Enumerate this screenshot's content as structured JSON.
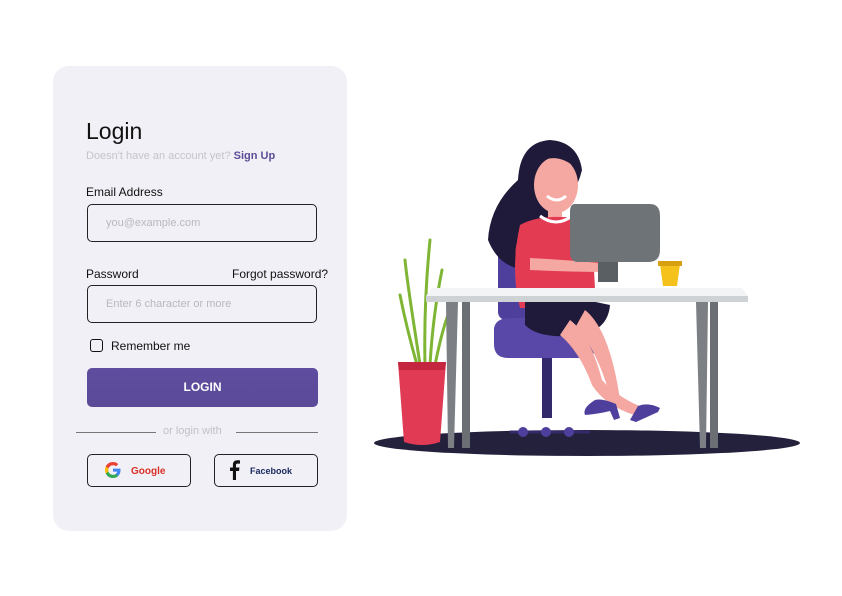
{
  "login_form": {
    "title": "Login",
    "no_account_text": "Doesn't have an account yet?",
    "signup_link": "Sign Up",
    "email_label": "Email Address",
    "email_placeholder": "you@example.com",
    "password_label": "Password",
    "forgot_password_link": "Forgot password?",
    "password_placeholder": "Enter 6 character or more",
    "remember_me_label": "Remember me",
    "remember_me_checked": false,
    "login_button": "LOGIN",
    "divider_text": "or login with",
    "google_button": "Google",
    "facebook_button": "Facebook"
  },
  "colors": {
    "accent": "#5c4b9b",
    "card_background": "#f1f0f6",
    "google_red": "#d93025",
    "facebook_blue": "#1b2a60"
  },
  "icons": [
    "google-icon",
    "facebook-icon",
    "checkbox"
  ]
}
